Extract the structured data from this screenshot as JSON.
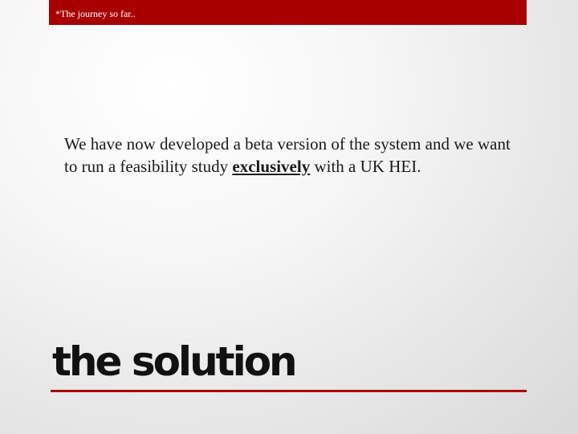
{
  "header": {
    "text": "*The journey so far.."
  },
  "body": {
    "before": "We have now developed a beta version of the system and we want to run a feasibility study ",
    "emphasis": "exclusively",
    "after": " with a UK HEI."
  },
  "title": {
    "text": "the solution"
  },
  "colors": {
    "accent": "#a80000",
    "text": "#1a1a1a"
  }
}
